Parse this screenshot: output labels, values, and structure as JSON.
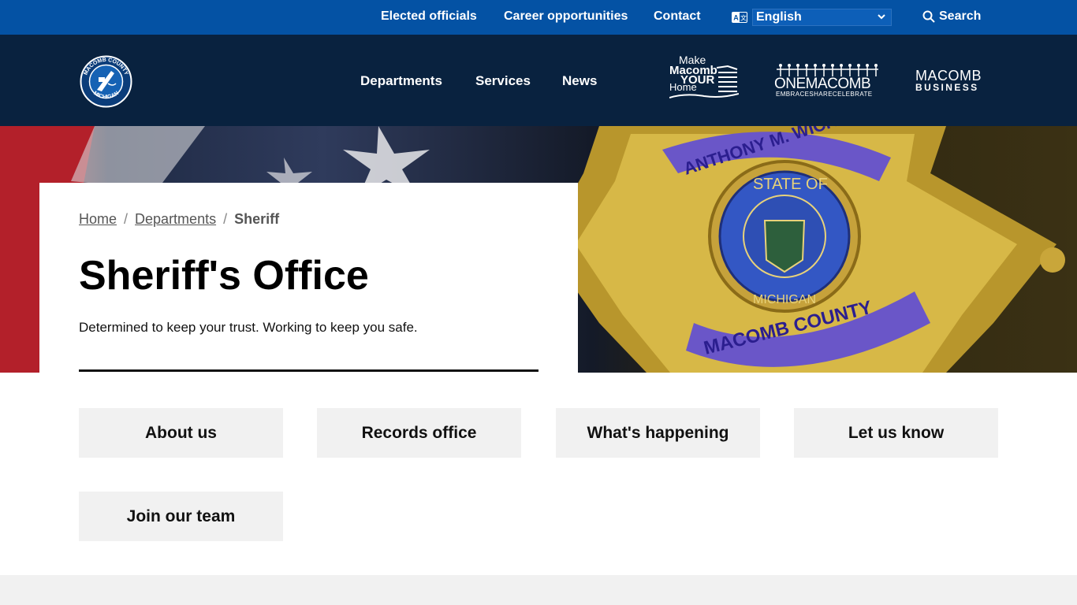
{
  "utility": {
    "links": [
      "Elected officials",
      "Career opportunities",
      "Contact"
    ],
    "language": "English",
    "search_label": "Search"
  },
  "nav": {
    "items": [
      "Departments",
      "Services",
      "News"
    ],
    "seal_text": "MACOMB COUNTY MICHIGAN",
    "partners": {
      "make_macomb": [
        "Make",
        "Macomb",
        "YOUR",
        "Home"
      ],
      "one_macomb": {
        "title": "ONEMACOMB",
        "tagline": "EMBRACESHARECELEBRATE"
      },
      "macomb_business": {
        "line1": "MACOMB",
        "line2": "BUSINESS"
      }
    }
  },
  "hero": {
    "breadcrumb": {
      "home": "Home",
      "departments": "Departments",
      "current": "Sheriff"
    },
    "title": "Sheriff's Office",
    "subtitle": "Determined to keep your trust. Working to keep you safe.",
    "badge_text": {
      "top": "ANTHONY M. WICKERSHAM",
      "state": "STATE OF",
      "michigan": "MICHIGAN",
      "county": "MACOMB COUNTY"
    }
  },
  "tiles": [
    "About us",
    "Records office",
    "What's happening",
    "Let us know",
    "Join our team"
  ],
  "colors": {
    "utility_bg": "#0452a4",
    "nav_bg": "#09223f",
    "tile_bg": "#f1f1f1"
  }
}
